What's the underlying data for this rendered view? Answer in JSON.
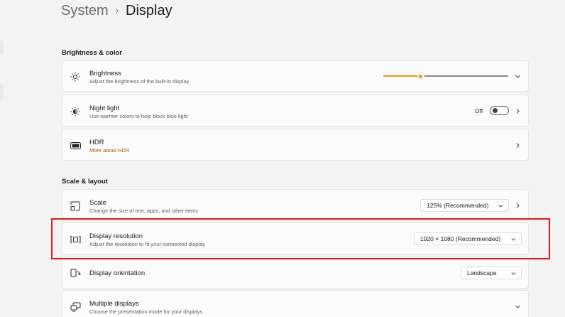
{
  "breadcrumb": {
    "parent": "System",
    "separator": "›",
    "current": "Display"
  },
  "sections": {
    "brightness_color": "Brightness & color",
    "scale_layout": "Scale & layout"
  },
  "brightness": {
    "title": "Brightness",
    "subtitle": "Adjust the brightness of the built-in display",
    "level_percent": 30,
    "accent_color": "#d99b12",
    "icon": "sun-icon"
  },
  "night_light": {
    "title": "Night light",
    "subtitle": "Use warmer colors to help block blue light",
    "state_label": "Off",
    "icon": "night-light-icon"
  },
  "hdr": {
    "title": "HDR",
    "link": "More about HDR",
    "link_color": "#9a5a00",
    "icon": "hdr-icon"
  },
  "scale": {
    "title": "Scale",
    "subtitle": "Change the size of text, apps, and other items",
    "value": "125% (Recommended)",
    "icon": "scale-icon"
  },
  "display_resolution": {
    "title": "Display resolution",
    "subtitle": "Adjust the resolution to fit your connected display",
    "value": "1920 × 1080 (Recommended)",
    "icon": "resolution-icon",
    "highlight_color": "#e01b1b"
  },
  "display_orientation": {
    "title": "Display orientation",
    "value": "Landscape",
    "icon": "orientation-icon"
  },
  "multiple_displays": {
    "title": "Multiple displays",
    "subtitle": "Choose the presentation mode for your displays",
    "icon": "multiple-displays-icon"
  }
}
